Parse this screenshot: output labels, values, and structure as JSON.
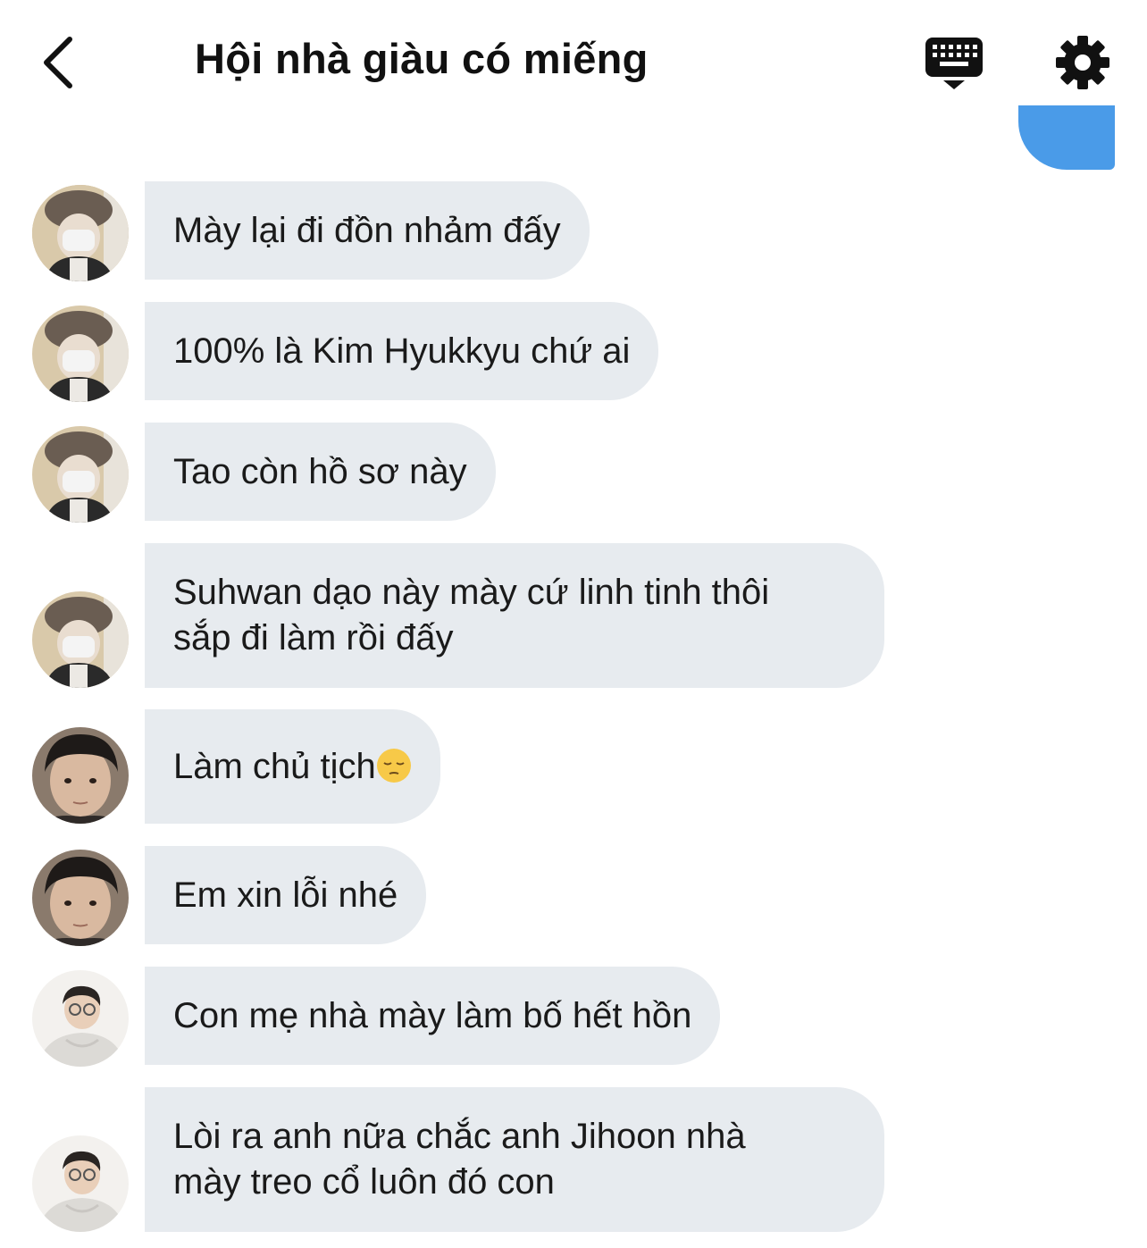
{
  "header": {
    "title": "Hội nhà giàu có miếng",
    "back_icon": "chevron-left-icon",
    "keyboard_icon": "keyboard-icon",
    "settings_icon": "gear-icon"
  },
  "messages": [
    {
      "sender": "user-a",
      "text": "Mày lại đi đồn nhảm đấy"
    },
    {
      "sender": "user-a",
      "text": "100% là Kim Hyukkyu chứ ai"
    },
    {
      "sender": "user-a",
      "text": "Tao còn hồ sơ này"
    },
    {
      "sender": "user-a",
      "text": "Suhwan dạo này mày cứ linh tinh thôi sắp đi làm rồi đấy",
      "lines": [
        "Suhwan dạo này mày cứ linh tinh thôi",
        "sắp đi làm rồi đấy"
      ]
    },
    {
      "sender": "user-b",
      "text": "Làm chủ tịch",
      "emoji": "pensive-face"
    },
    {
      "sender": "user-b",
      "text": "Em xin lỗi nhé"
    },
    {
      "sender": "user-c",
      "text": "Con mẹ nhà mày làm bố hết hồn"
    },
    {
      "sender": "user-c",
      "text": "Lòi ra anh nữa chắc anh Jihoon nhà mày treo cổ luôn đó con",
      "lines": [
        "Lòi ra anh nữa chắc anh Jihoon nhà",
        "mày treo cổ luôn đó con"
      ]
    }
  ],
  "colors": {
    "incoming_bubble": "#e7ebef",
    "outgoing_bubble": "#4a9be8",
    "text": "#1a1a1a"
  }
}
